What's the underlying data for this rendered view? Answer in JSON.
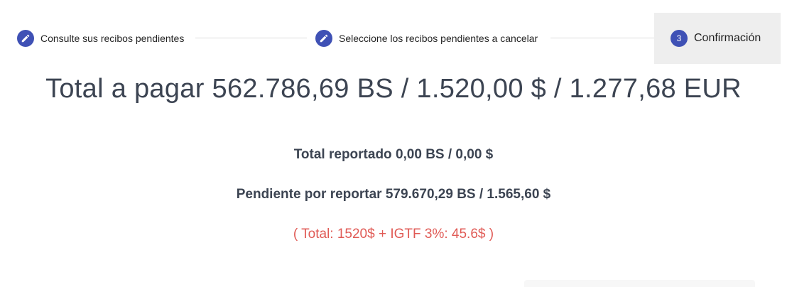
{
  "stepper": {
    "steps": [
      {
        "label": "Consulte sus recibos pendientes",
        "icon": "edit-icon"
      },
      {
        "label": "Seleccione los recibos pendientes a cancelar",
        "icon": "edit-icon"
      },
      {
        "number": "3",
        "label": "Confirmación"
      }
    ]
  },
  "summary": {
    "total_title": "Total a pagar 562.786,69 BS / 1.520,00 $ / 1.277,68 EUR",
    "reported": "Total reportado 0,00 BS / 0,00 $",
    "pending": "Pendiente por reportar 579.670,29 BS / 1.565,60 $",
    "igtf_note": "( Total: 1520$ + IGTF 3%: 45.6$ )"
  },
  "colors": {
    "accent": "#3f51b5",
    "text": "#3c4452",
    "warning": "#e05a55",
    "active_step_bg": "#eeeeee"
  }
}
